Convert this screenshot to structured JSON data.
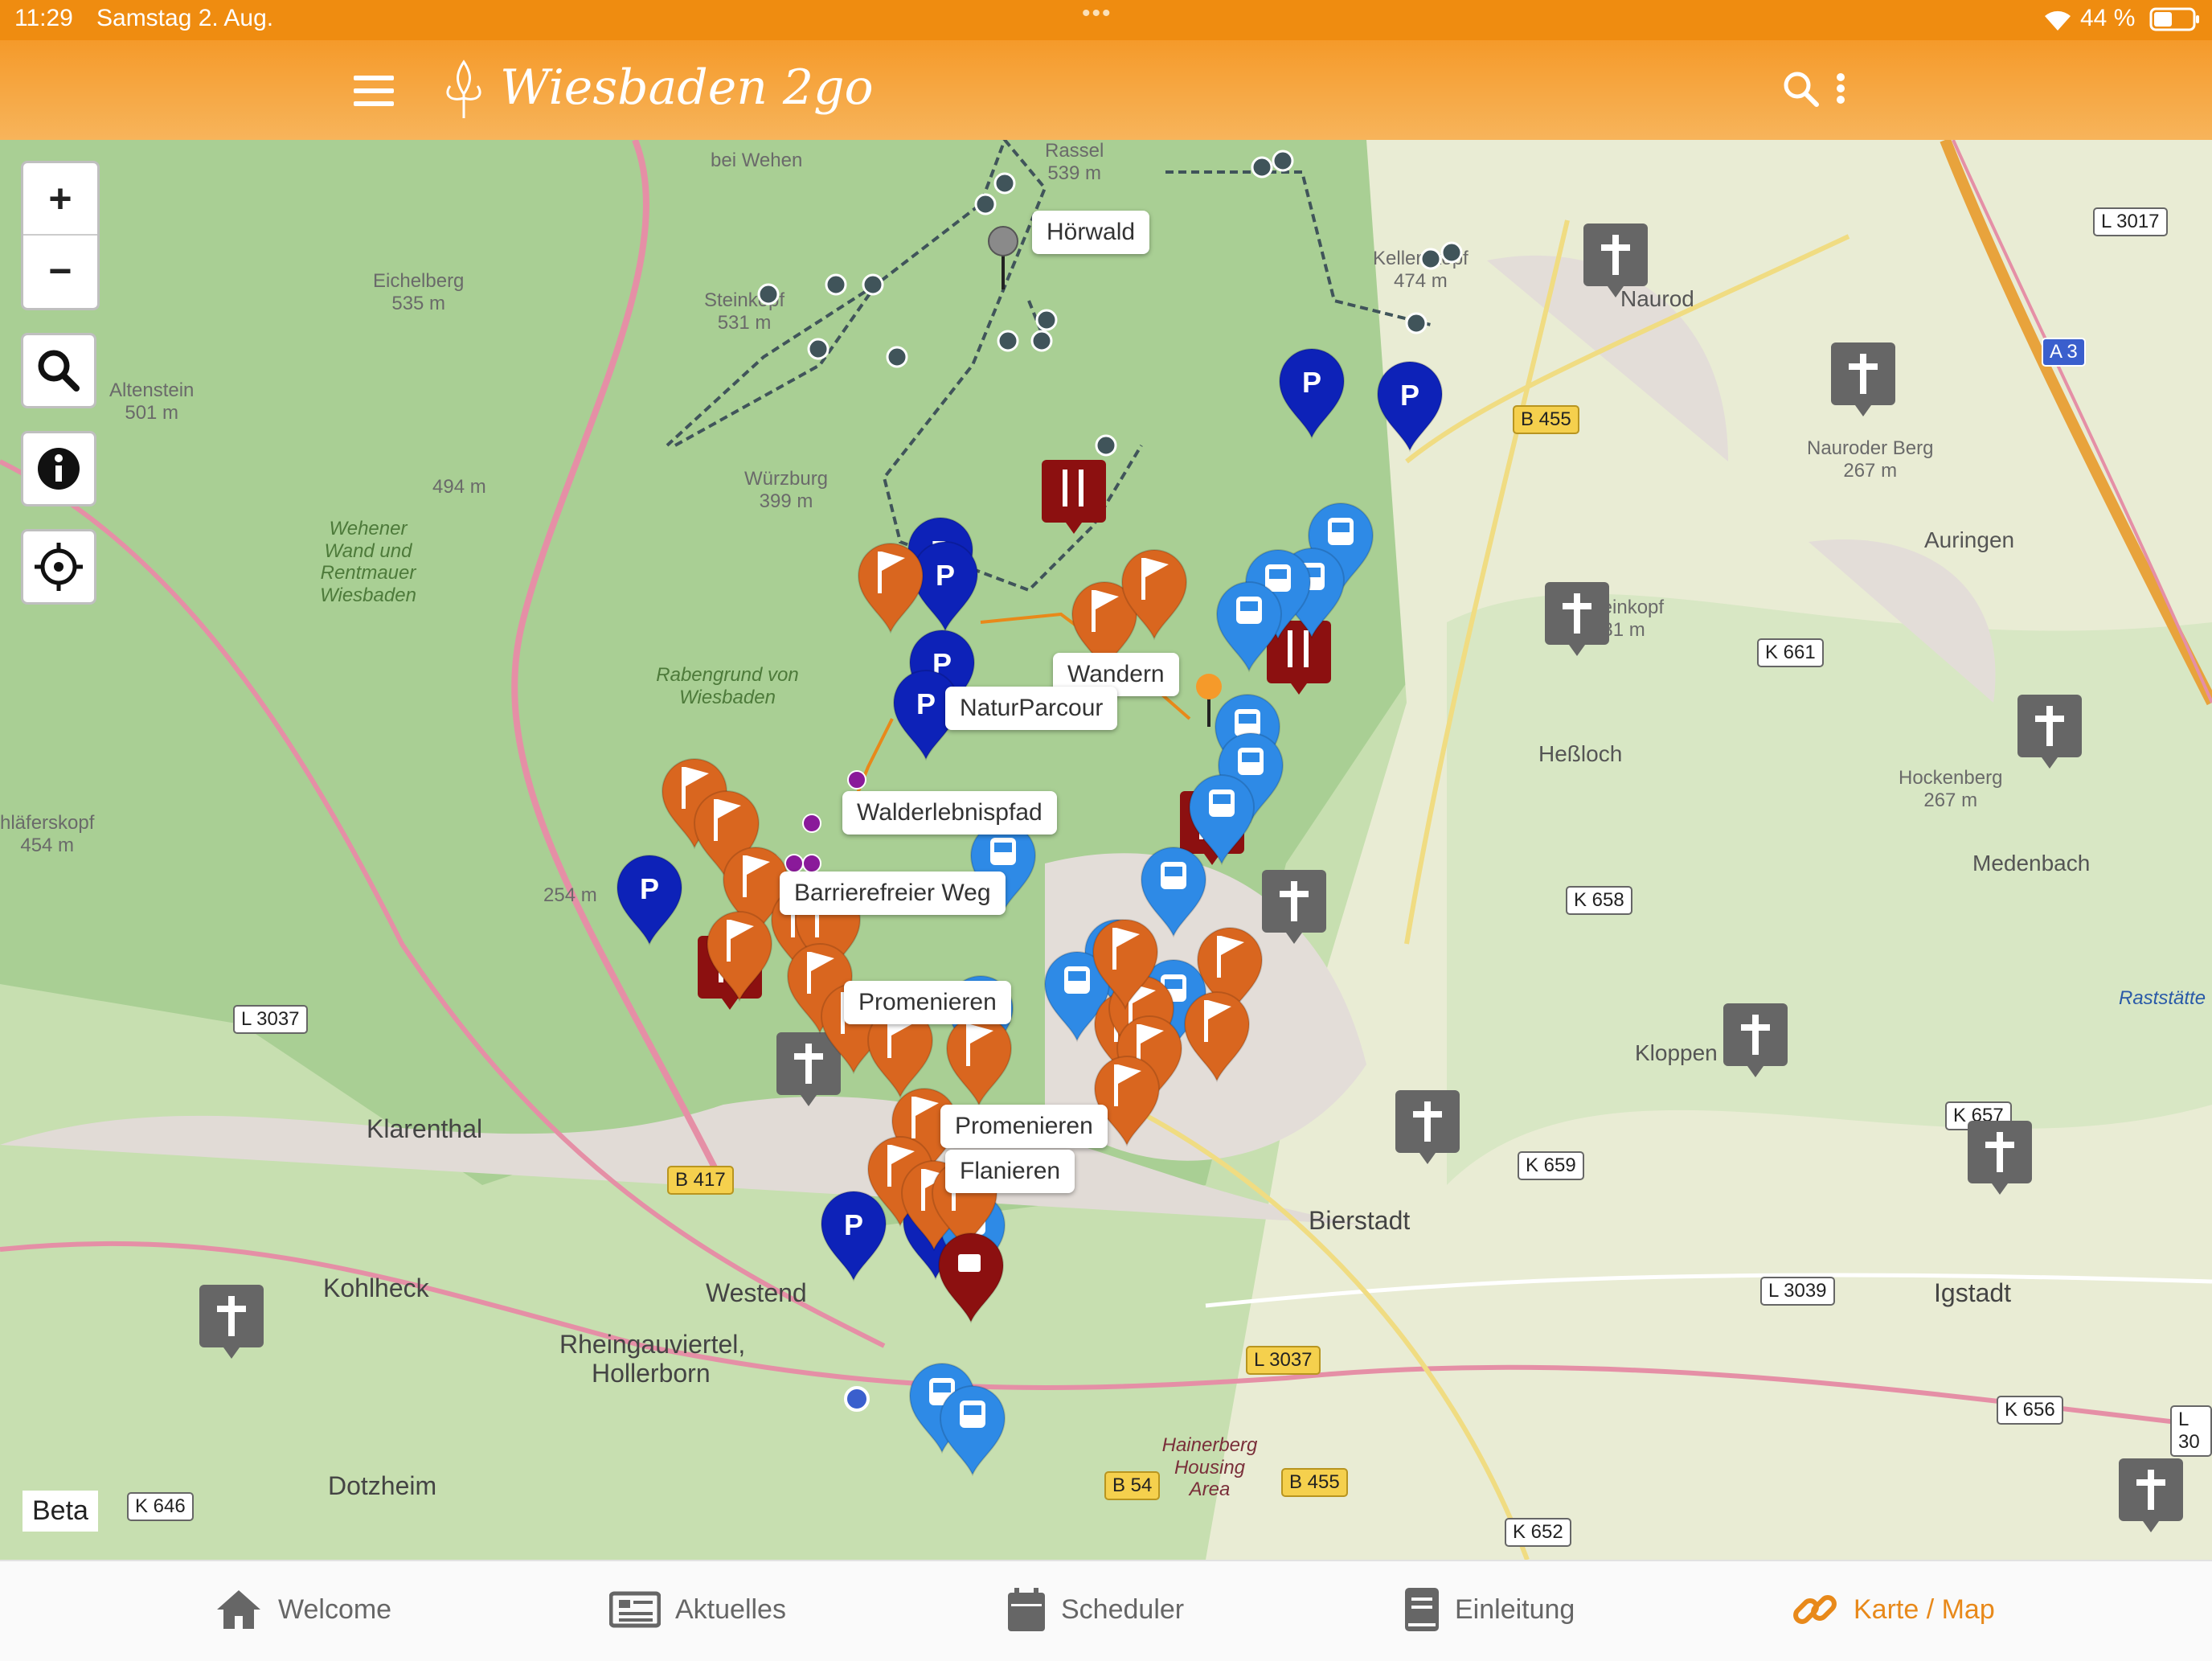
{
  "status": {
    "time": "11:29",
    "date": "Samstag 2. Aug.",
    "dots": "•••",
    "battery": "44 %"
  },
  "header": {
    "logo_text": "Wiesbaden 2go",
    "menu_icon": "hamburger-menu-icon",
    "search_icon": "search-icon",
    "more_icon": "more-vertical-icon"
  },
  "map_controls": {
    "zoom_in": "+",
    "zoom_out": "−",
    "beta": "Beta"
  },
  "callouts": {
    "hoerwald": "Hörwald",
    "wandern": "Wandern",
    "naturparcour": "NaturParcour",
    "walderlebnispfad": "Walderlebnispfad",
    "barrierefrei": "Barrierefreier Weg",
    "promenieren1": "Promenieren",
    "promenieren2": "Promenieren",
    "flanieren": "Flanieren"
  },
  "places": {
    "rassel": "Rassel",
    "rassel_h": "539 m",
    "eichelberg": "Eichelberg",
    "eichelberg_h": "535 m",
    "steinkopf": "Steinkopf",
    "steinkopf_h": "531 m",
    "altenstein": "Altenstein",
    "altenstein_h": "501 m",
    "wuerzburg": "Würzburg",
    "wuerzburg_h": "399 m",
    "p494": "494 m",
    "wehener": "Wehener Wand und Rentmauer Wiesbaden",
    "rabengrund": "Rabengrund von Wiesbaden",
    "schlaferskopf": "hläferskopf",
    "schlaferskopf_h": "454 m",
    "p254": "254 m",
    "naurod": "Naurod",
    "nauroderberg": "Nauroder Berg",
    "nauroderberg_h": "267 m",
    "auringen": "Auringen",
    "steinkopf2": "Steinkopf",
    "steinkopf2_h": "31 m",
    "hessloch": "Heßloch",
    "hockenberg": "Hockenberg",
    "hockenberg_h": "267 m",
    "medenbach": "Medenbach",
    "kloppen": "Kloppen",
    "klarenthal": "Klarenthal",
    "bierstadt": "Bierstadt",
    "igstadt": "Igstadt",
    "kohlheck": "Kohlheck",
    "westend": "Westend",
    "rheingau": "Rheingauviertel,",
    "hollerborn": "Hollerborn",
    "dotzheim": "Dotzheim",
    "hainerberg": "Hainerberg Housing Area",
    "raststaette": "Raststätte",
    "kellerskopf": "Kellerskopf",
    "kellerskopf_h": "474 m",
    "wehen": "bei Wehen"
  },
  "roads": {
    "l3017": "L 3017",
    "a3": "A 3",
    "b455a": "B 455",
    "k661": "K 661",
    "k658": "K 658",
    "l3037a": "L 3037",
    "b417": "B 417",
    "k657": "K 657",
    "k659": "K 659",
    "l3039": "L 3039",
    "l3037b": "L 3037",
    "k656": "K 656",
    "b54": "B 54",
    "b455b": "B 455",
    "k646": "K 646",
    "k652": "K 652",
    "l30": "L 30"
  },
  "tabs": [
    {
      "label": "Welcome",
      "icon": "home-icon"
    },
    {
      "label": "Aktuelles",
      "icon": "newspaper-icon"
    },
    {
      "label": "Scheduler",
      "icon": "calendar-icon"
    },
    {
      "label": "Einleitung",
      "icon": "book-icon"
    },
    {
      "label": "Karte / Map",
      "icon": "link-icon"
    }
  ],
  "colors": {
    "accent": "#ef8c10",
    "parking": "#0d22b8",
    "bus": "#2e8ae6",
    "flag": "#d9661f",
    "food": "#8c1010",
    "cross": "#666666",
    "trail": "#40545a"
  }
}
